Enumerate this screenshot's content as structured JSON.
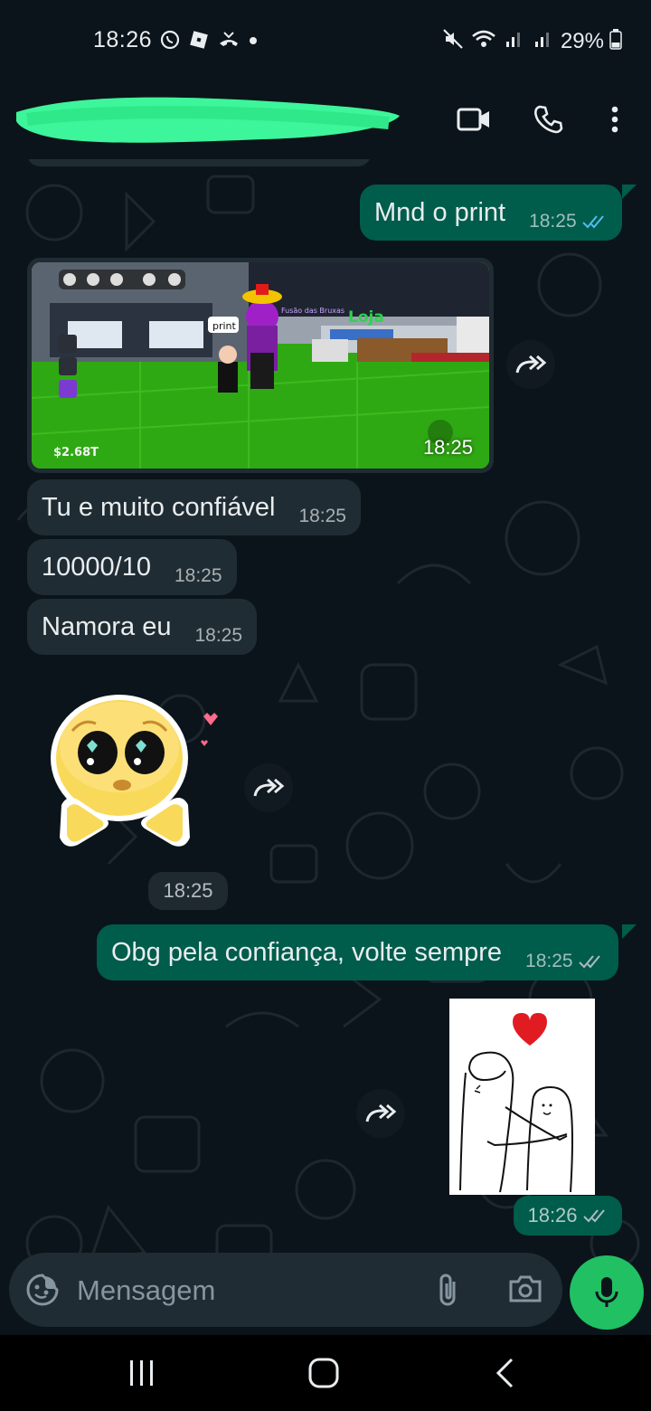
{
  "status_bar": {
    "time": "18:26",
    "battery": "29%"
  },
  "header": {
    "contact_name_redacted": true
  },
  "messages": {
    "m1": {
      "text": "Mnd o print",
      "time": "18:25"
    },
    "m2": {
      "time": "18:25",
      "game_labels": {
        "shop": "Loja",
        "money": "$2.68T",
        "sign": "print",
        "title": "Fusão das Bruxas"
      }
    },
    "m3": {
      "text": "Tu e muito confiável",
      "time": "18:25"
    },
    "m4": {
      "text": "10000/10",
      "time": "18:25"
    },
    "m5": {
      "text": "Namora eu",
      "time": "18:25"
    },
    "m6": {
      "time": "18:25"
    },
    "m7": {
      "text": "Obg pela confiança, volte sempre",
      "time": "18:25"
    },
    "m8": {
      "time": "18:26"
    }
  },
  "composer": {
    "placeholder": "Mensagem"
  },
  "colors": {
    "outgoing": "#005c4b",
    "incoming": "#202c33",
    "accent": "#21c063",
    "read_tick": "#53bdeb"
  }
}
